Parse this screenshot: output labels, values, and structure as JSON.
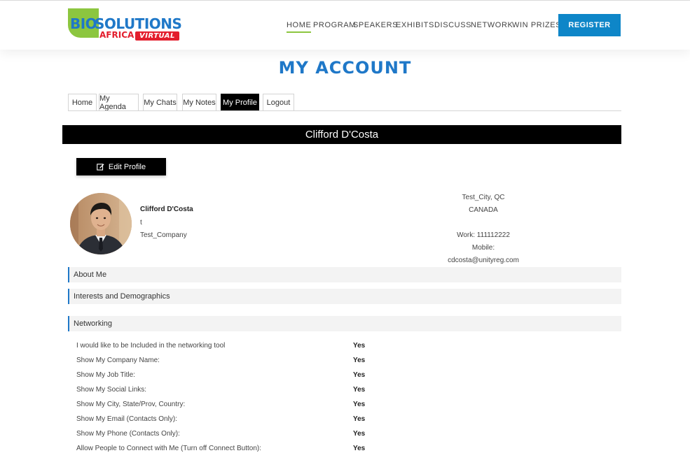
{
  "brand": {
    "logo_bio": "BIO",
    "logo_solutions": "SOLUTIONS",
    "logo_africa": "AFRICA",
    "logo_virtual": "VIRTUAL",
    "colors": {
      "blue": "#1f78c8",
      "green": "#8cc63f",
      "red": "#e31e2d"
    }
  },
  "nav": {
    "items": [
      {
        "label": "HOME",
        "active": true
      },
      {
        "label": "PROGRAM"
      },
      {
        "label": "SPEAKERS"
      },
      {
        "label": "EXHIBITS"
      },
      {
        "label": "DISCUSS"
      },
      {
        "label": "NETWORK"
      },
      {
        "label": "WIN PRIZES"
      }
    ],
    "register_label": "REGISTER"
  },
  "page": {
    "title": "MY ACCOUNT"
  },
  "tabs": [
    {
      "label": "Home"
    },
    {
      "label": "My Agenda"
    },
    {
      "label": "My Chats"
    },
    {
      "label": "My Notes"
    },
    {
      "label": "My Profile",
      "active": true
    },
    {
      "label": "Logout"
    }
  ],
  "profile": {
    "banner_name": "Clifford D'Costa",
    "edit_label": "Edit Profile",
    "name": "Clifford D'Costa",
    "job_title": "t",
    "company": "Test_Company",
    "city_state": "Test_City, QC",
    "country": "CANADA",
    "work_phone": "Work: 111112222",
    "mobile": "Mobile:",
    "email": "cdcosta@unityreg.com"
  },
  "sections": {
    "about": "About Me",
    "interests": "Interests and Demographics",
    "networking": "Networking"
  },
  "networking_prefs": [
    {
      "label": "I would like to be Included in the networking tool",
      "value": "Yes"
    },
    {
      "label": "Show My Company Name:",
      "value": "Yes"
    },
    {
      "label": "Show My Job Title:",
      "value": "Yes"
    },
    {
      "label": "Show My Social Links:",
      "value": "Yes"
    },
    {
      "label": "Show My City, State/Prov, Country:",
      "value": "Yes"
    },
    {
      "label": "Show My Email (Contacts Only):",
      "value": "Yes"
    },
    {
      "label": "Show My Phone (Contacts Only):",
      "value": "Yes"
    },
    {
      "label": "Allow People to Connect with Me (Turn off Connect Button):",
      "value": "Yes"
    }
  ]
}
